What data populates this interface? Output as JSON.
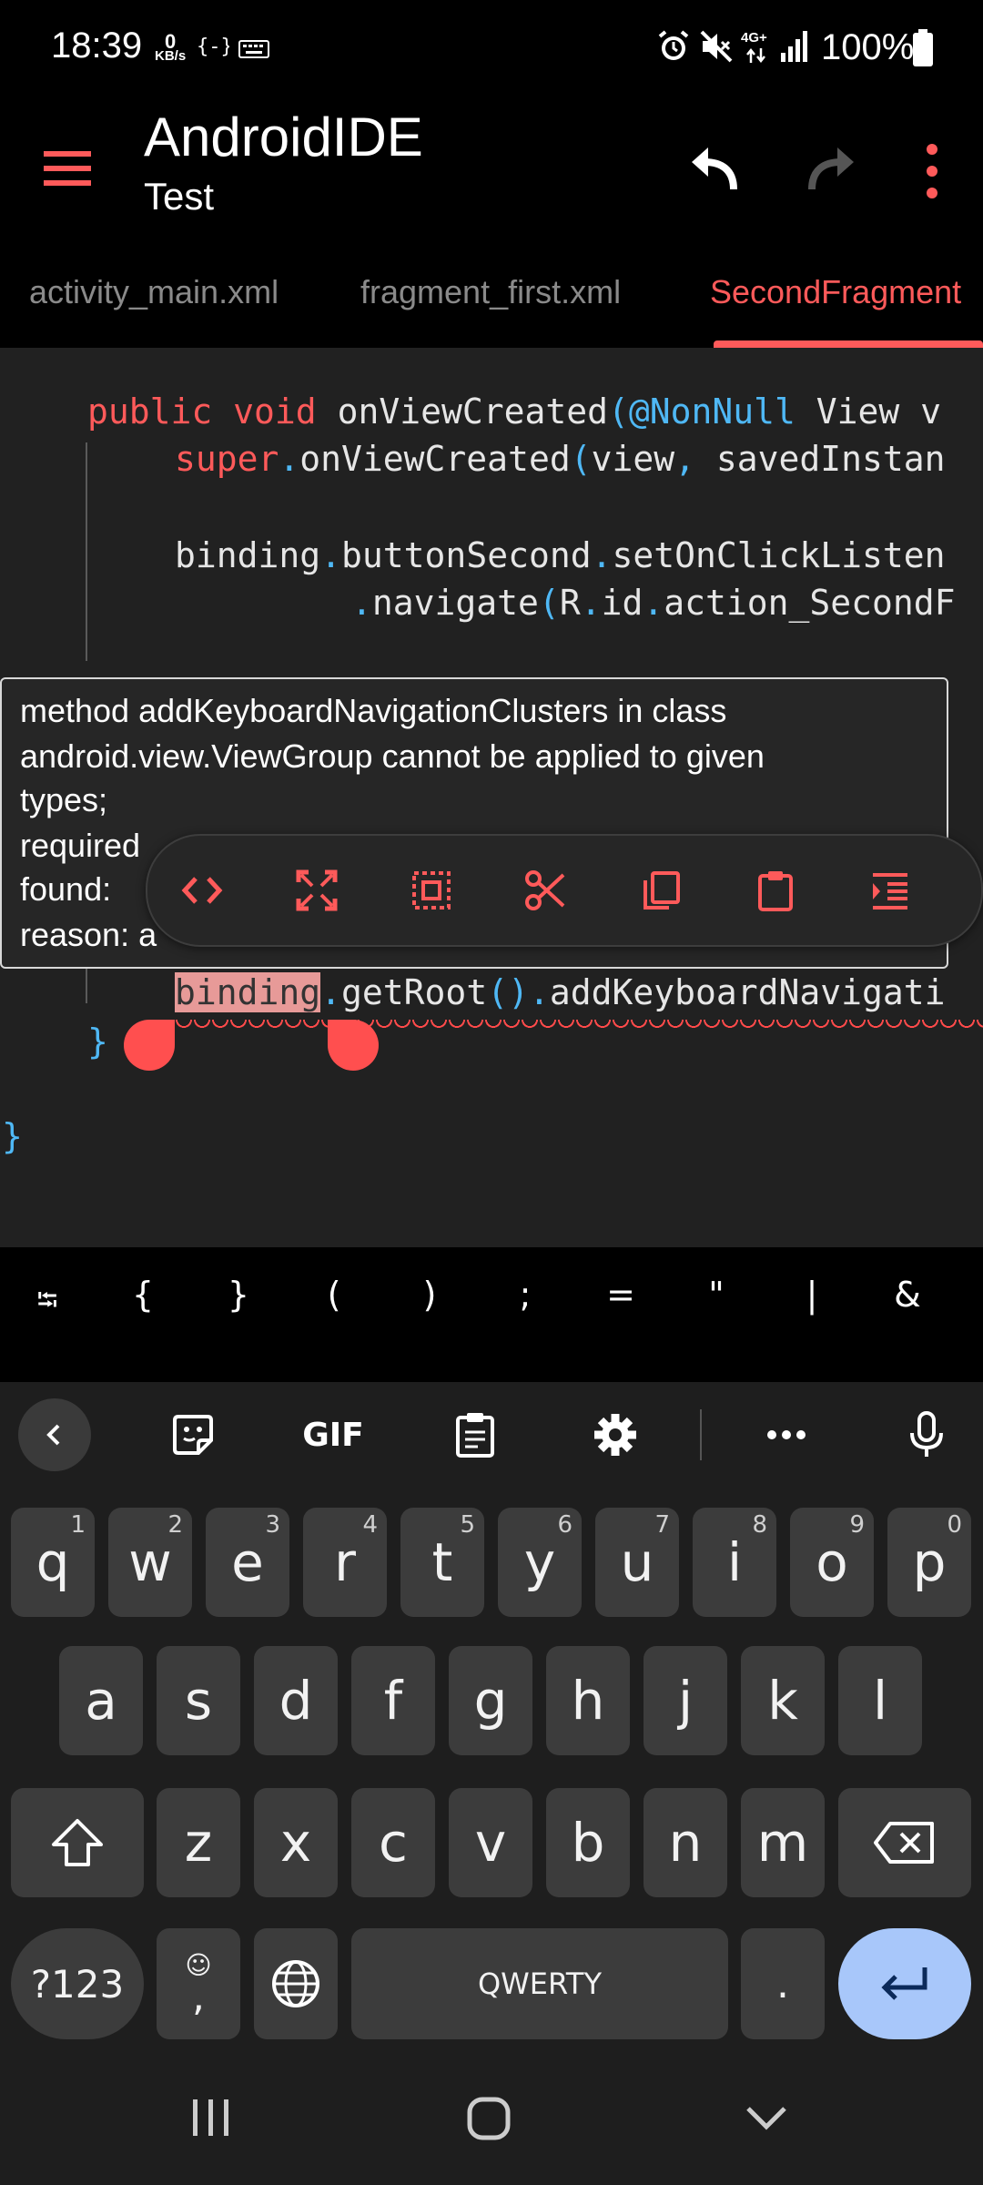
{
  "status_bar": {
    "time": "18:39",
    "net_speed_value": "0",
    "net_speed_unit": "KB/s",
    "battery": "100%",
    "network": "4G+"
  },
  "app_bar": {
    "title": "AndroidIDE",
    "subtitle": "Test",
    "icons": [
      "menu-icon",
      "undo-icon",
      "redo-icon",
      "more-vert-icon"
    ]
  },
  "tabs": [
    {
      "label": "activity_main.xml",
      "active": false
    },
    {
      "label": "fragment_first.xml",
      "active": false
    },
    {
      "label": "SecondFragment",
      "active": true
    }
  ],
  "editor": {
    "line1": {
      "kw1": "public",
      "kw2": "void",
      "name": "onViewCreated",
      "ann": "(@NonNull",
      "rest": " View v"
    },
    "line2": {
      "kw": "super",
      "dot": ".",
      "call": "onViewCreated",
      "p": "(",
      "args1": "view",
      "comma": ",",
      "args2": " savedInstan"
    },
    "line3": {
      "obj": "binding",
      "d1": ".",
      "f1": "buttonSecond",
      "d2": ".",
      "f2": "setOnClickListen"
    },
    "line4": {
      "d0": ".",
      "f": "navigate",
      "p": "(",
      "r": "R",
      "d1": ".",
      "id": "id",
      "d2": ".",
      "rest": "action_SecondF"
    },
    "line5": {
      "sel": "binding",
      "d1": ".",
      "call": "getRoot",
      "pp": "()",
      "d2": ".",
      "rest": "addKeyboardNavigati"
    },
    "brace_inner": "}",
    "brace_outer": "}"
  },
  "tooltip": {
    "line1": "method addKeyboardNavigationClusters in class",
    "line2": "android.view.ViewGroup cannot be applied to given",
    "line3": "types;",
    "line4": "  required",
    "line5": "  found:",
    "line6": "  reason: a"
  },
  "action_popup": {
    "icons": [
      "code-icon",
      "expand-selection-icon",
      "select-all-icon",
      "cut-icon",
      "copy-icon",
      "paste-icon",
      "indent-icon"
    ]
  },
  "symbol_bar": {
    "symbols": [
      "⭾",
      "{",
      "}",
      "(",
      ")",
      ";",
      "=",
      "\"",
      "|",
      "&"
    ]
  },
  "keyboard": {
    "toolbar": [
      "back-icon",
      "sticker-icon",
      "GIF",
      "clipboard-icon",
      "settings-icon",
      "more-icon",
      "mic-icon"
    ],
    "gif_label": "GIF",
    "row1": [
      {
        "ch": "q",
        "hint": "1"
      },
      {
        "ch": "w",
        "hint": "2"
      },
      {
        "ch": "e",
        "hint": "3"
      },
      {
        "ch": "r",
        "hint": "4"
      },
      {
        "ch": "t",
        "hint": "5"
      },
      {
        "ch": "y",
        "hint": "6"
      },
      {
        "ch": "u",
        "hint": "7"
      },
      {
        "ch": "i",
        "hint": "8"
      },
      {
        "ch": "o",
        "hint": "9"
      },
      {
        "ch": "p",
        "hint": "0"
      }
    ],
    "row2": [
      "a",
      "s",
      "d",
      "f",
      "g",
      "h",
      "j",
      "k",
      "l"
    ],
    "row3": [
      "z",
      "x",
      "c",
      "v",
      "b",
      "n",
      "m"
    ],
    "symbols_key": "?123",
    "comma_key": ",",
    "emoji_hint": "☺",
    "space_label": "QWERTY",
    "period_key": "."
  },
  "colors": {
    "accent": "#ff5a5a",
    "annotation": "#4fb8f5",
    "editor_bg": "#212121",
    "keyboard_bg": "#1e1e1e",
    "enter_key": "#a8c7fa"
  }
}
